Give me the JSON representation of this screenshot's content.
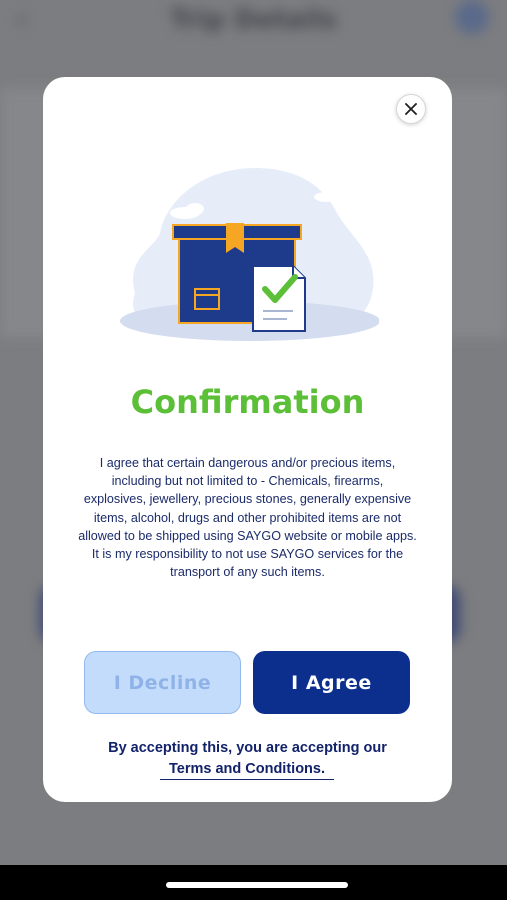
{
  "background": {
    "header_title": "Trip Details",
    "back_glyph": "‹"
  },
  "modal": {
    "close_glyph": "✕",
    "illustration_icon": "package-with-checked-document",
    "title": "Confirmation",
    "body_lines": [
      "I agree that certain dangerous and/or precious items,",
      "including but not limited to - Chemicals, firearms,",
      "explosives, jewellery, precious stones, generally expensive",
      "items, alcohol, drugs and other prohibited items are not",
      "allowed to be shipped using SAYGO website or mobile apps.",
      "It is my responsibility to not use SAYGO services for the",
      "transport of any such items."
    ],
    "decline_label": "I Decline",
    "agree_label": "I Agree",
    "terms_lead": "By accepting this, you are accepting our",
    "terms_link": "Terms and Conditions."
  },
  "colors": {
    "title_green": "#5cbf38",
    "navy": "#0c2f8e",
    "decline_bg": "#c4dcfb",
    "box_blue": "#1e3a8a",
    "tape_orange": "#f5a623"
  }
}
